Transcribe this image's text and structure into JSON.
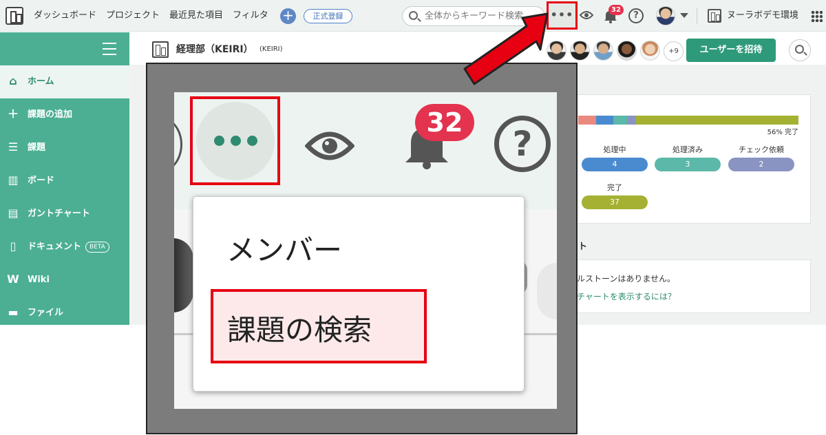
{
  "topbar": {
    "nav": [
      "ダッシュボード",
      "プロジェクト",
      "最近見た項目",
      "フィルタ"
    ],
    "register_label": "正式登録",
    "search_placeholder": "全体からキーワード検索",
    "more_label": "•••",
    "notification_count": "32",
    "help_label": "?",
    "space_name": "ヌーラボデモ環境"
  },
  "sidebar": {
    "items": [
      {
        "label": "ホーム",
        "icon": "home-icon"
      },
      {
        "label": "課題の追加",
        "icon": "plus-icon"
      },
      {
        "label": "課題",
        "icon": "list-icon"
      },
      {
        "label": "ボード",
        "icon": "board-icon"
      },
      {
        "label": "ガントチャート",
        "icon": "gantt-icon"
      },
      {
        "label": "ドキュメント",
        "icon": "document-icon",
        "badge": "BETA"
      },
      {
        "label": "Wiki",
        "icon": "wiki-icon"
      },
      {
        "label": "ファイル",
        "icon": "file-icon"
      }
    ]
  },
  "project": {
    "name": "経理部（KEIRI）",
    "key": "(KEIRI)",
    "more_members": "+9",
    "invite_label": "ユーザーを招待"
  },
  "status": {
    "percent_label": "56% 完了",
    "items": [
      {
        "label": "処理中",
        "count": "4",
        "color": "#4a8bd0"
      },
      {
        "label": "処理済み",
        "count": "3",
        "color": "#5cb8a8"
      },
      {
        "label": "チェック依頼",
        "count": "2",
        "color": "#8a94c2"
      },
      {
        "label": "完了",
        "count": "37",
        "color": "#a4b132"
      }
    ]
  },
  "milestone": {
    "title_fragment": "ト",
    "empty_text": "ルストーンはありません。",
    "link_text": "チャートを表示するには？"
  },
  "zoom": {
    "more_label": "•••",
    "notification_count": "32",
    "help_label": "?",
    "menu": {
      "member_label": "メンバー",
      "search_label": "課題の検索"
    }
  },
  "colors": {
    "accent_green": "#4caf93",
    "highlight_red": "#e60012",
    "badge_red": "#e3334e"
  }
}
